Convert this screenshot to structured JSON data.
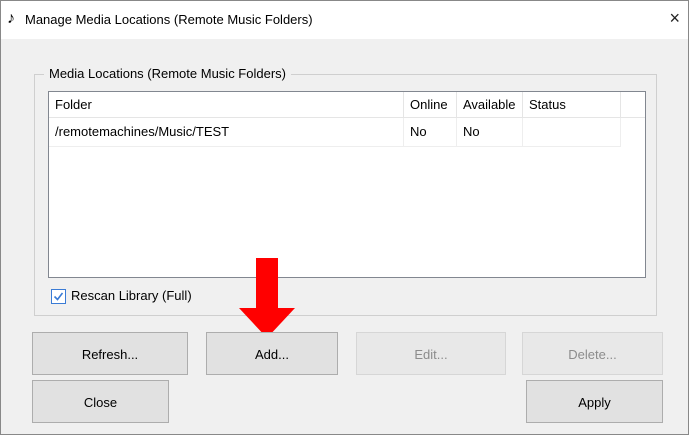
{
  "window": {
    "title": "Manage Media Locations (Remote Music Folders)",
    "icon": "music-note-icon",
    "close_label": "×"
  },
  "group": {
    "label": "Media Locations (Remote Music Folders)"
  },
  "list": {
    "columns": [
      "Folder",
      "Online",
      "Available",
      "Status"
    ],
    "rows": [
      {
        "folder": "/remotemachines/Music/TEST",
        "online": "No",
        "available": "No",
        "status": ""
      }
    ]
  },
  "rescan": {
    "label": "Rescan Library (Full)",
    "checked": true
  },
  "buttons": {
    "refresh": "Refresh...",
    "add": "Add...",
    "edit": "Edit...",
    "delete": "Delete...",
    "close": "Close",
    "apply": "Apply"
  },
  "colors": {
    "arrow": "#ff0000",
    "checkbox_accent": "#3a7bd5"
  }
}
